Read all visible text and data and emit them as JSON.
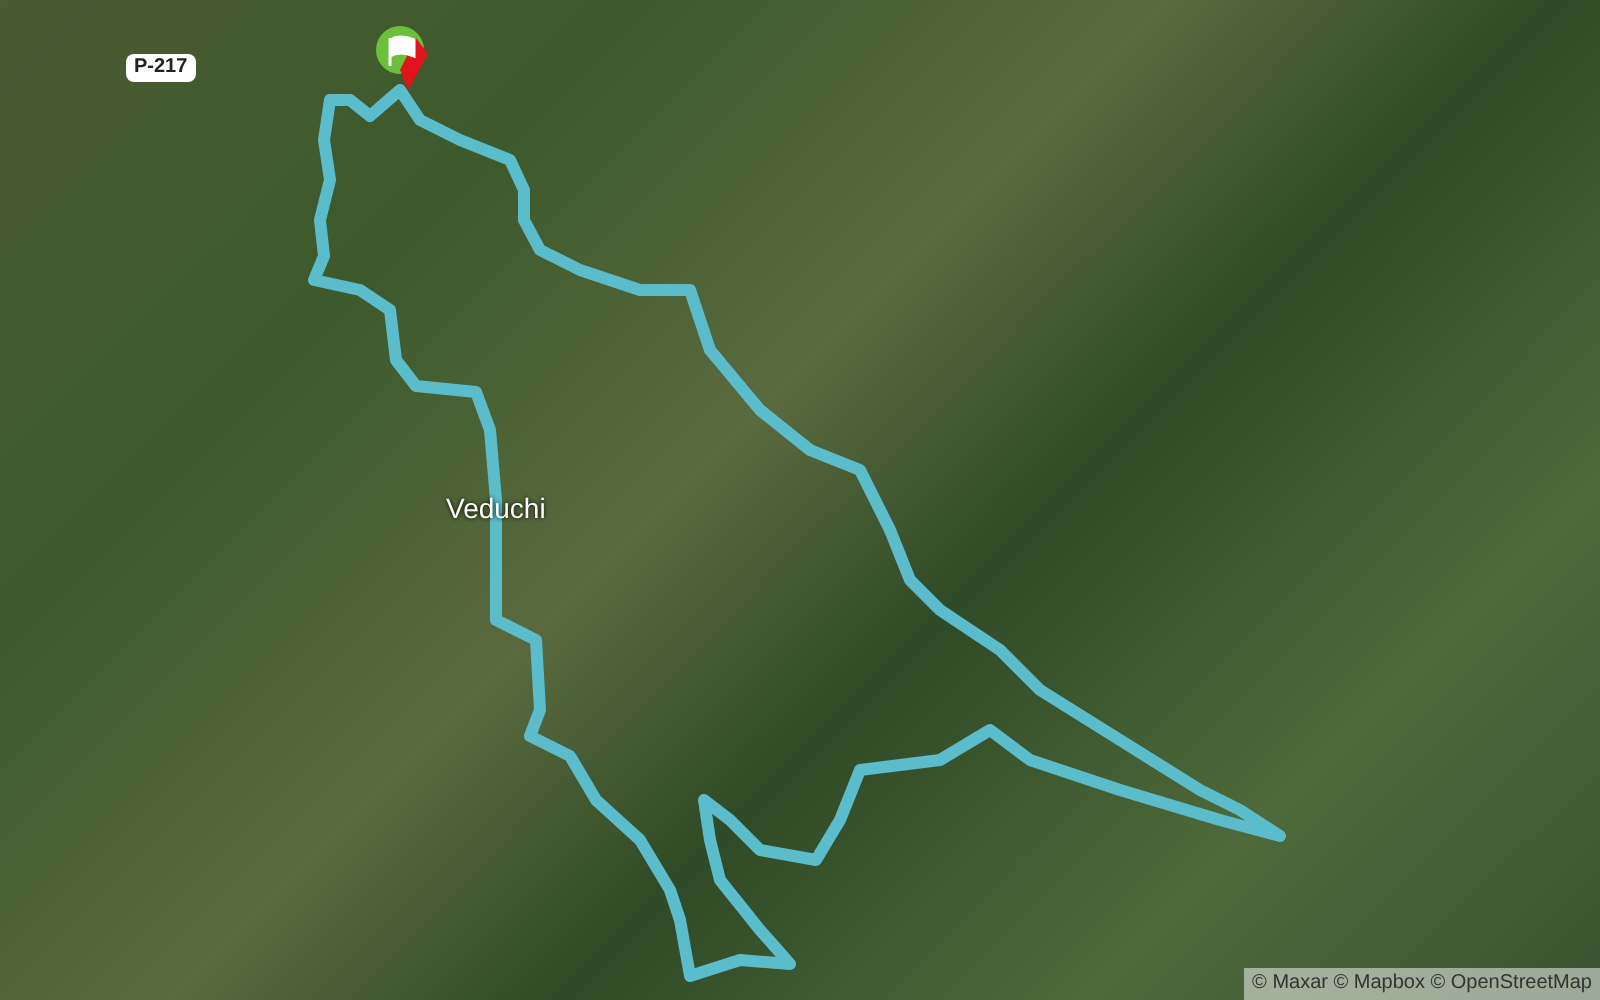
{
  "map": {
    "road_label": "P-217",
    "place_label": "Veduchi"
  },
  "attribution": "© Maxar © Mapbox © OpenStreetMap"
}
